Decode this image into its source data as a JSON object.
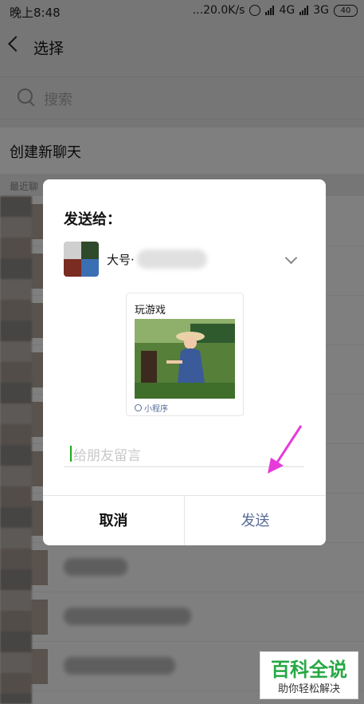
{
  "status_bar": {
    "time": "晚上8:48",
    "speed": "...20.0K/s",
    "network_1": "4G",
    "network_2": "3G",
    "battery": "40"
  },
  "header": {
    "title": "选择"
  },
  "search": {
    "placeholder": "搜索"
  },
  "create_chat": {
    "label": "创建新聊天"
  },
  "recent": {
    "title": "最近聊"
  },
  "dialog": {
    "title": "发送给：",
    "recipient_name": "大号·",
    "card": {
      "title": "玩游戏",
      "footer": "小程序"
    },
    "message_placeholder": "给朋友留言",
    "cancel_label": "取消",
    "send_label": "发送"
  },
  "watermark": {
    "main": "百科全说",
    "sub": "助你轻松解决"
  },
  "colors": {
    "link_blue": "#576b95",
    "caret_green": "#1aad19",
    "watermark_green": "#27a844",
    "annotation_pink": "#e63bd8"
  }
}
